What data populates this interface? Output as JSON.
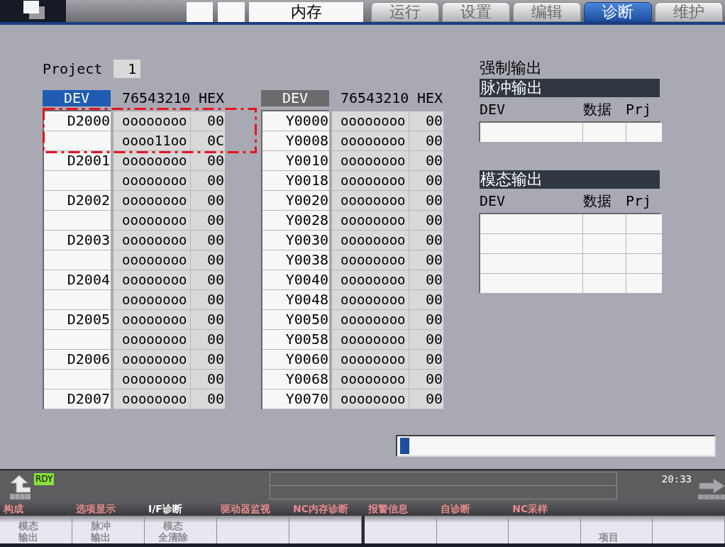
{
  "top_bar": {
    "mode": "内存",
    "tabs": [
      {
        "label": "运行",
        "selected": false
      },
      {
        "label": "设置",
        "selected": false
      },
      {
        "label": "编辑",
        "selected": false
      },
      {
        "label": "诊断",
        "selected": true
      },
      {
        "label": "维护",
        "selected": false
      }
    ]
  },
  "project": {
    "label": "Project",
    "value": "1"
  },
  "device_tables": [
    {
      "selected": true,
      "dev_header": "DEV",
      "bits_header": "76543210",
      "hex_header": "HEX",
      "rows": [
        {
          "dev": "D2000",
          "bits": "oooooooo",
          "hex": "00",
          "highlighted": true
        },
        {
          "bits": "oooo11oo",
          "hex": "0C",
          "highlighted": true
        },
        {
          "dev": "D2001",
          "bits": "oooooooo",
          "hex": "00",
          "highlighted": false
        },
        {
          "bits": "oooooooo",
          "hex": "00",
          "highlighted": false
        },
        {
          "dev": "D2002",
          "bits": "oooooooo",
          "hex": "00",
          "highlighted": false
        },
        {
          "bits": "oooooooo",
          "hex": "00",
          "highlighted": false
        },
        {
          "dev": "D2003",
          "bits": "oooooooo",
          "hex": "00",
          "highlighted": false
        },
        {
          "bits": "oooooooo",
          "hex": "00",
          "highlighted": false
        },
        {
          "dev": "D2004",
          "bits": "oooooooo",
          "hex": "00",
          "highlighted": false
        },
        {
          "bits": "oooooooo",
          "hex": "00",
          "highlighted": false
        },
        {
          "dev": "D2005",
          "bits": "oooooooo",
          "hex": "00",
          "highlighted": false
        },
        {
          "bits": "oooooooo",
          "hex": "00",
          "highlighted": false
        },
        {
          "dev": "D2006",
          "bits": "oooooooo",
          "hex": "00",
          "highlighted": false
        },
        {
          "bits": "oooooooo",
          "hex": "00",
          "highlighted": false
        },
        {
          "dev": "D2007",
          "bits": "oooooooo",
          "hex": "00",
          "highlighted": false
        }
      ]
    },
    {
      "selected": false,
      "dev_header": "DEV",
      "bits_header": "76543210",
      "hex_header": "HEX",
      "rows": [
        {
          "dev": "Y0000",
          "bits": "oooooooo",
          "hex": "00",
          "highlighted": false
        },
        {
          "dev": "Y0008",
          "bits": "oooooooo",
          "hex": "00",
          "highlighted": false
        },
        {
          "dev": "Y0010",
          "bits": "oooooooo",
          "hex": "00",
          "highlighted": false
        },
        {
          "dev": "Y0018",
          "bits": "oooooooo",
          "hex": "00",
          "highlighted": false
        },
        {
          "dev": "Y0020",
          "bits": "oooooooo",
          "hex": "00",
          "highlighted": false
        },
        {
          "dev": "Y0028",
          "bits": "oooooooo",
          "hex": "00",
          "highlighted": false
        },
        {
          "dev": "Y0030",
          "bits": "oooooooo",
          "hex": "00",
          "highlighted": false
        },
        {
          "dev": "Y0038",
          "bits": "oooooooo",
          "hex": "00",
          "highlighted": false
        },
        {
          "dev": "Y0040",
          "bits": "oooooooo",
          "hex": "00",
          "highlighted": false
        },
        {
          "dev": "Y0048",
          "bits": "oooooooo",
          "hex": "00",
          "highlighted": false
        },
        {
          "dev": "Y0050",
          "bits": "oooooooo",
          "hex": "00",
          "highlighted": false
        },
        {
          "dev": "Y0058",
          "bits": "oooooooo",
          "hex": "00",
          "highlighted": false
        },
        {
          "dev": "Y0060",
          "bits": "oooooooo",
          "hex": "00",
          "highlighted": false
        },
        {
          "dev": "Y0068",
          "bits": "oooooooo",
          "hex": "00",
          "highlighted": false
        },
        {
          "dev": "Y0070",
          "bits": "oooooooo",
          "hex": "00",
          "highlighted": false
        }
      ]
    }
  ],
  "forced_output": {
    "title": "强制输出",
    "sections": [
      {
        "title": "脉冲输出",
        "columns": [
          "DEV",
          "数据",
          "Prj"
        ],
        "rows": [
          {
            "kind": "empty"
          }
        ]
      },
      {
        "title": "模态输出",
        "columns": [
          "DEV",
          "数据",
          "Prj"
        ],
        "rows": [
          {
            "kind": "empty"
          },
          {
            "kind": "empty"
          },
          {
            "kind": "empty"
          },
          {
            "kind": "empty"
          }
        ]
      }
    ]
  },
  "progress": {
    "level": 0.03
  },
  "status": {
    "ready": "RDY",
    "time": "20:33"
  },
  "menu": [
    {
      "label": "构成",
      "selected": false
    },
    {
      "label": "选项显示",
      "selected": false
    },
    {
      "label": "I/F诊断",
      "selected": true
    },
    {
      "label": "驱动器监视",
      "selected": false
    },
    {
      "label": "NC内存诊断",
      "selected": false
    },
    {
      "label": "报警信息",
      "selected": false
    },
    {
      "label": "自诊断",
      "selected": false
    },
    {
      "label": "NC采样",
      "selected": false
    }
  ],
  "softkeys": [
    {
      "kind": "label",
      "lines": [
        "模态",
        "输出"
      ]
    },
    {
      "kind": "label",
      "lines": [
        "脉冲",
        "输出"
      ]
    },
    {
      "kind": "label",
      "lines": [
        "模态",
        "全清除"
      ]
    },
    {
      "kind": "blank"
    },
    {
      "kind": "blank"
    },
    {
      "kind": "blank"
    },
    {
      "kind": "blank"
    },
    {
      "kind": "blank"
    },
    {
      "kind": "label",
      "lines": [
        "项目"
      ]
    },
    {
      "kind": "blank"
    }
  ]
}
